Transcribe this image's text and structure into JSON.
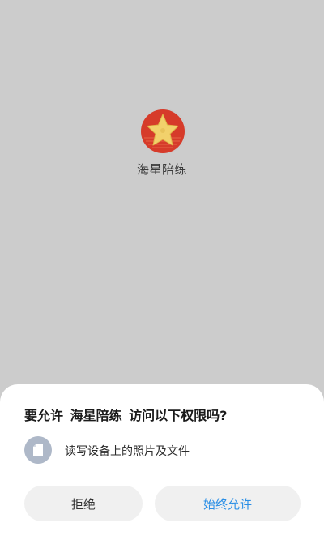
{
  "app": {
    "name": "海星陪练",
    "logo_icon": "starfish-logo-icon"
  },
  "permission_dialog": {
    "title": "要允许 海星陪练 访问以下权限吗?",
    "permissions": [
      {
        "icon": "file-icon",
        "label": "读写设备上的照片及文件"
      }
    ],
    "deny_label": "拒绝",
    "allow_label": "始终允许"
  },
  "colors": {
    "background": "#cccccc",
    "sheet": "#ffffff",
    "button_bg": "#f0f0f0",
    "accent": "#2b8fe6",
    "logo_red": "#d63b2a",
    "logo_star": "#f2d16b"
  }
}
